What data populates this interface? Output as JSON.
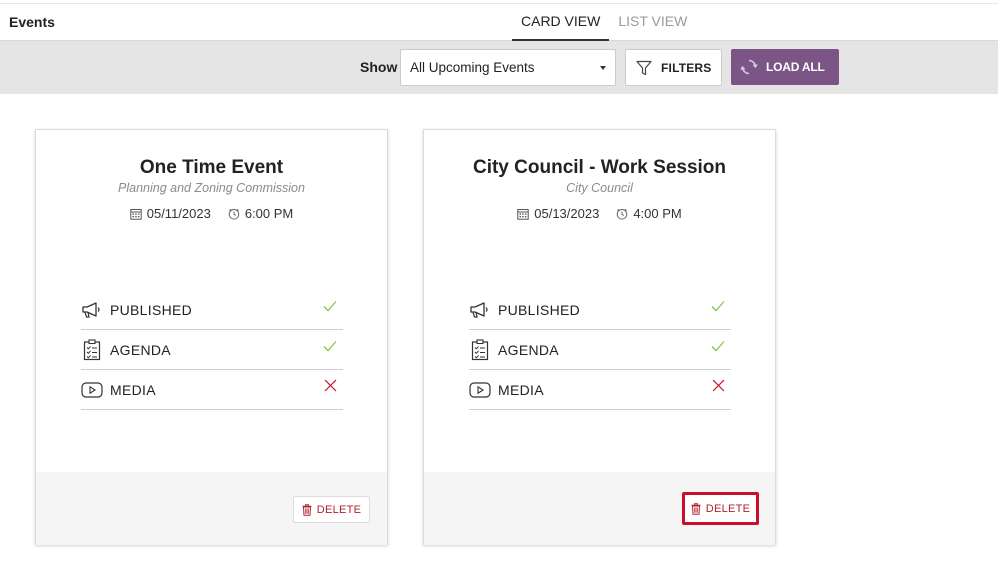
{
  "header": {
    "title": "Events",
    "tabs": [
      {
        "label": "CARD VIEW",
        "active": true
      },
      {
        "label": "LIST VIEW",
        "active": false
      }
    ]
  },
  "toolbar": {
    "show_label": "Show",
    "select_value": "All Upcoming Events",
    "filters_label": "FILTERS",
    "load_all_label": "LOAD ALL"
  },
  "colors": {
    "accent": "#7b5585",
    "check": "#8bc34a",
    "cross": "#c8102e",
    "delete_text": "#b0222d"
  },
  "cards": [
    {
      "title": "One Time Event",
      "subtitle": "Planning and Zoning Commission",
      "date": "05/11/2023",
      "time": "6:00 PM",
      "statuses": [
        {
          "label": "PUBLISHED",
          "icon": "megaphone-icon",
          "ok": true
        },
        {
          "label": "AGENDA",
          "icon": "clipboard-list-icon",
          "ok": true
        },
        {
          "label": "MEDIA",
          "icon": "play-icon",
          "ok": false
        }
      ],
      "delete_label": "DELETE"
    },
    {
      "title": "City Council - Work Session",
      "subtitle": "City Council",
      "date": "05/13/2023",
      "time": "4:00 PM",
      "statuses": [
        {
          "label": "PUBLISHED",
          "icon": "megaphone-icon",
          "ok": true
        },
        {
          "label": "AGENDA",
          "icon": "clipboard-list-icon",
          "ok": true
        },
        {
          "label": "MEDIA",
          "icon": "play-icon",
          "ok": false
        }
      ],
      "delete_label": "DELETE"
    }
  ]
}
